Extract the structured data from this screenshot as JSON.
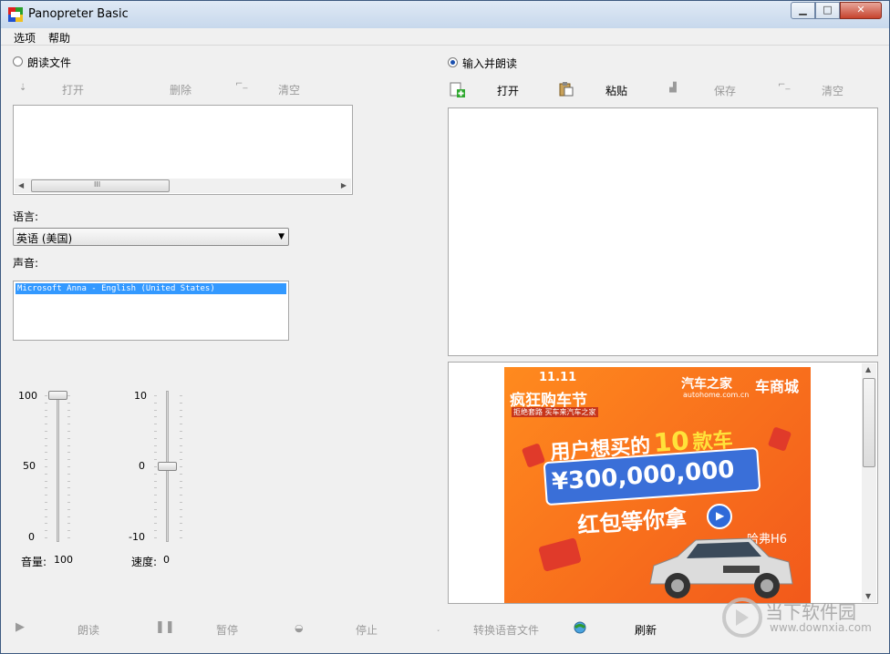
{
  "window": {
    "title": "Panopreter Basic"
  },
  "menu": {
    "options": "选项",
    "help": "帮助"
  },
  "read_file": {
    "radio_label": "朗读文件",
    "toolbar": {
      "open": "打开",
      "delete": "删除",
      "clear": "清空"
    },
    "scroll_grip": "III"
  },
  "language": {
    "label": "语言:",
    "selected": "英语 (美国)"
  },
  "voice": {
    "label": "声音:",
    "selected": "Microsoft Anna - English (United States)"
  },
  "volume": {
    "max": "100",
    "mid": "50",
    "min": "0",
    "label": "音量:",
    "value": "100",
    "level": 1.0
  },
  "speed": {
    "max": "10",
    "mid": "0",
    "min": "-10",
    "label": "速度:",
    "value": "0",
    "level": 0.5
  },
  "input_read": {
    "radio_label": "输入并朗读",
    "toolbar": {
      "open": "打开",
      "paste": "粘贴",
      "save": "保存",
      "clear": "清空"
    }
  },
  "ad": {
    "event": "11.11",
    "event_title": "疯狂购车节",
    "event_sub": "拒绝套路 买车来汽车之家",
    "brand": "汽车之家",
    "brand_url": "autohome.com.cn",
    "brand2": "车商城",
    "headline_1": "用户想买的",
    "headline_num": "10",
    "headline_2": "款车",
    "amount": "¥300,000,000",
    "tagline": "红包等你拿",
    "car_model": "哈弗H6"
  },
  "bottom_bar": {
    "read": "朗读",
    "pause": "暂停",
    "stop": "停止",
    "convert": "转换语音文件",
    "refresh": "刷新"
  },
  "watermark": {
    "name": "当下软件园",
    "url": "www.downxia.com"
  },
  "colors": {
    "selection": "#3399ff",
    "ad_orange": "#f2591b",
    "radio_dot": "#1a4fae"
  }
}
